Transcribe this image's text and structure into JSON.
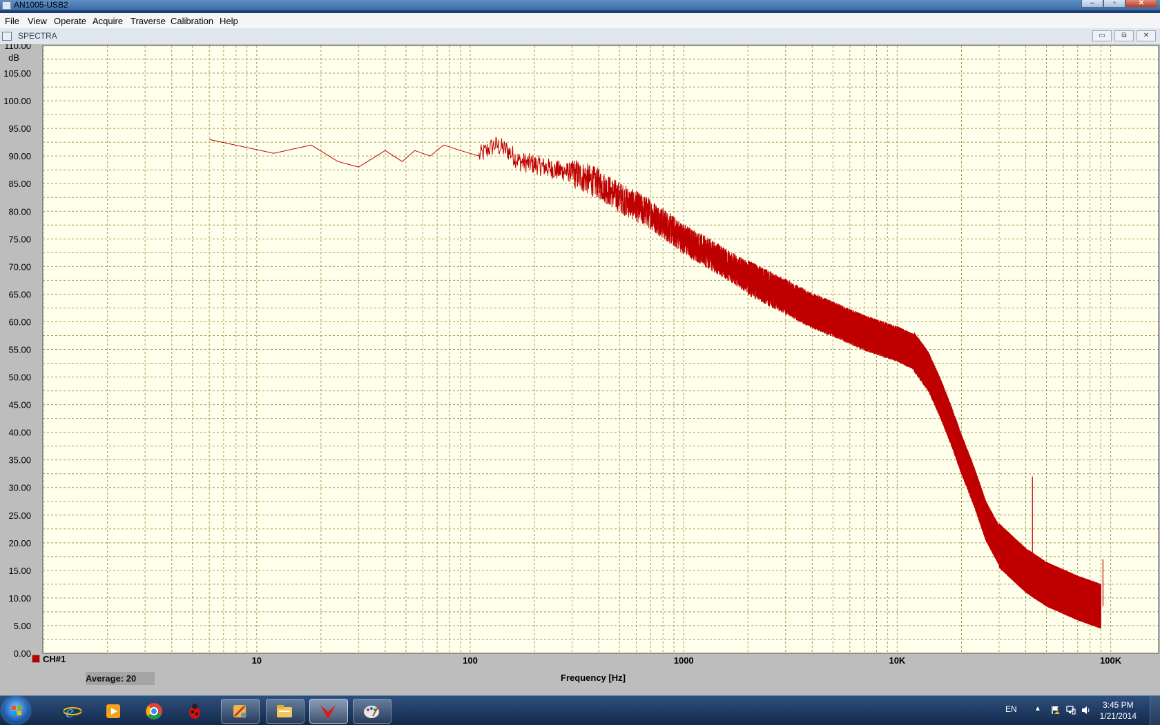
{
  "window": {
    "title": "AN1005-USB2"
  },
  "menu": [
    "File",
    "View",
    "Operate",
    "Acquire",
    "Traverse",
    "Calibration",
    "Help"
  ],
  "subwindow": {
    "title": "SPECTRA"
  },
  "status": {
    "average": "Average: 20"
  },
  "colors": {
    "trace": "#c00000",
    "grid": "#8a8a3a",
    "plot_bg": "#ffffec",
    "panel": "#bdbdbd"
  },
  "chart_data": {
    "type": "line",
    "xlabel": "Frequency [Hz]",
    "ylabel": "dB",
    "x_scale": "log",
    "xlim": [
      1,
      100000
    ],
    "ylim": [
      0,
      110
    ],
    "x_tick_labels": [
      "10",
      "100",
      "1000",
      "10K",
      "100K"
    ],
    "y_tick_labels": [
      "0.00",
      "5.00",
      "10.00",
      "15.00",
      "20.00",
      "25.00",
      "30.00",
      "35.00",
      "40.00",
      "45.00",
      "50.00",
      "55.00",
      "60.00",
      "65.00",
      "70.00",
      "75.00",
      "80.00",
      "85.00",
      "90.00",
      "95.00",
      "100.00",
      "105.00",
      "110.00"
    ],
    "grid": true,
    "legend": "bottom-left",
    "series": [
      {
        "name": "CH#1",
        "envelope": [
          [
            6,
            93
          ],
          [
            12,
            90.5
          ],
          [
            18,
            92
          ],
          [
            24,
            89
          ],
          [
            30,
            88
          ],
          [
            40,
            91
          ],
          [
            48,
            89
          ],
          [
            55,
            91
          ],
          [
            65,
            90
          ],
          [
            75,
            92
          ],
          [
            90,
            91
          ],
          [
            110,
            90
          ],
          [
            130,
            92
          ],
          [
            150,
            91
          ],
          [
            170,
            89
          ],
          [
            200,
            88.5
          ],
          [
            250,
            87.5
          ],
          [
            300,
            87
          ],
          [
            400,
            85
          ],
          [
            500,
            82.5
          ],
          [
            700,
            79.5
          ],
          [
            1000,
            75
          ],
          [
            1500,
            71
          ],
          [
            2000,
            68
          ],
          [
            3000,
            64.5
          ],
          [
            4000,
            62
          ],
          [
            5000,
            60.5
          ],
          [
            7000,
            58
          ],
          [
            10000,
            56
          ],
          [
            12000,
            54.5
          ],
          [
            14000,
            51
          ],
          [
            16000,
            46
          ],
          [
            18000,
            41
          ],
          [
            20000,
            36
          ],
          [
            23000,
            30
          ],
          [
            26000,
            24
          ],
          [
            30000,
            19.5
          ],
          [
            40000,
            15
          ],
          [
            50000,
            12.5
          ],
          [
            70000,
            10
          ],
          [
            90000,
            8.5
          ]
        ],
        "spikes": [
          [
            43000,
            32
          ],
          [
            92000,
            17
          ],
          [
            55000,
            15.5
          ]
        ]
      }
    ]
  },
  "taskbar": {
    "tray_lang": "EN",
    "time": "3:45 PM",
    "date": "1/21/2014"
  }
}
